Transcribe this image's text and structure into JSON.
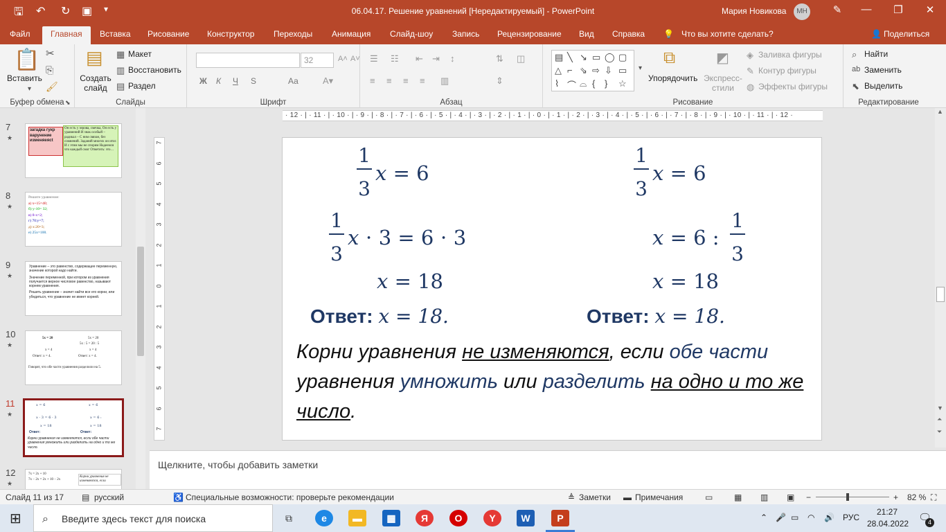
{
  "titlebar": {
    "title": "06.04.17. Решение уравнений [Нередактируемый]  -  PowerPoint",
    "user": "Мария Новикова",
    "initials": "МН"
  },
  "tabs": [
    "Файл",
    "Главная",
    "Вставка",
    "Рисование",
    "Конструктор",
    "Переходы",
    "Анимация",
    "Слайд-шоу",
    "Запись",
    "Рецензирование",
    "Вид",
    "Справка"
  ],
  "tell_me": "Что вы хотите сделать?",
  "share": "Поделиться",
  "ribbon": {
    "clipboard": {
      "label": "Буфер обмена",
      "paste": "Вставить"
    },
    "slides": {
      "label": "Слайды",
      "new_slide_1": "Создать",
      "new_slide_2": "слайд",
      "layout": "Макет",
      "reset": "Восстановить",
      "section": "Раздел"
    },
    "font": {
      "label": "Шрифт",
      "size": "32",
      "bold": "Ж",
      "italic": "К",
      "underline": "Ч",
      "strike": "S",
      "case": "Аа"
    },
    "paragraph": {
      "label": "Абзац"
    },
    "drawing": {
      "label": "Рисование",
      "arrange": "Упорядочить",
      "quick_1": "Экспресс-",
      "quick_2": "стили",
      "fill": "Заливка фигуры",
      "outline": "Контур фигуры",
      "effects": "Эффекты фигуры"
    },
    "editing": {
      "label": "Редактирование",
      "find": "Найти",
      "replace": "Заменить",
      "select": "Выделить"
    }
  },
  "thumbs": [
    {
      "num": "7",
      "title": "загадка гукр варунение изменяеясt",
      "poem": "Он есть у зерова, смечка, Он есть у уравнений И знак особый – радикал – С ним связан, без сомнений. Заданий многих он итог. И с этим мы не спорим Надеемся что каждый смог Ответить: это…"
    },
    {
      "num": "8",
      "lines": [
        "Решите уравнение:",
        "а) x+15=40;",
        "б) y-10= 32;",
        "в) 8-x=2;",
        "г) 70:y=7;",
        "д) x:20=3;",
        "е) 25x=100."
      ]
    },
    {
      "num": "9",
      "p1": "Уравнение – это равенство, содержащее переменную, значение которой надо найти.",
      "p2": "Значение переменной, при котором из уравнения получается верное числовое равенство, называют корнем уравнения.",
      "p3": "Решить уравнение – значит найти все его корни, или убедиться, что уравнение не имеет корней."
    },
    {
      "num": "10",
      "a": "5x = 20",
      "b": "5x = 20",
      "c": "5x : 5 = 20 : 5",
      "d": "x = 4",
      "e": "x = 4",
      "ans1": "Ответ: x = 4.",
      "ans2": "Ответ: x = 4.",
      "note": "Говорят, что обе части уравнения разделили на 5."
    },
    {
      "num": "11",
      "note": "Корни уравнения не изменяются, если обе части уравнения умножить или разделить на одно и то же число."
    },
    {
      "num": "12",
      "a": "7x = 2x + 10",
      "b": "7x − 2x = 2x + 10 − 2x",
      "note": "Корни уравнения не изменяются, если"
    }
  ],
  "slide": {
    "frac_num": "1",
    "frac_den": "3",
    "l1_rest": "𝑥 = 6",
    "l2_left_rest": "𝑥 ⋅ 3 = 6 ⋅ 3",
    "l2_right_pre": "𝑥 = 6 :",
    "l3": "𝑥 = 18",
    "answer_label": "Ответ:",
    "answer_value": "x = 18.",
    "text": {
      "p1": "Корни уравнения ",
      "p2": "не изменяются",
      "p3": ", если ",
      "p4": "обе части",
      "p5": " уравнения ",
      "p6": "умножить",
      "p7": " или ",
      "p8": "разделить",
      "p9": " ",
      "p10": "на одно и то же число",
      "p11": "."
    }
  },
  "hruler": "· 12 · | · 11 · | · 10 · | · 9 · | · 8 · | · 7 · | · 6 · | · 5 · | · 4 · | · 3 · | · 2 · | · 1 · | · 0 · | · 1 · | · 2 · | · 3 · | · 4 · | · 5 · | · 6 · | · 7 · | · 8 · | · 9 · | · 10 · | · 11 · | · 12 ·",
  "vruler": [
    "7",
    "6",
    "5",
    "4",
    "3",
    "2",
    "1",
    "0",
    "1",
    "2",
    "3",
    "4",
    "5",
    "6",
    "7"
  ],
  "notes": "Щелкните, чтобы добавить заметки",
  "status": {
    "slide": "Слайд 11 из 17",
    "lang": "русский",
    "access": "Специальные возможности: проверьте рекомендации",
    "notes": "Заметки",
    "comments": "Примечания",
    "zoom": "82 %"
  },
  "taskbar": {
    "search": "Введите здесь текст для поиска",
    "lang": "РУС",
    "time": "21:27",
    "date": "28.04.2022",
    "badge": "4"
  }
}
